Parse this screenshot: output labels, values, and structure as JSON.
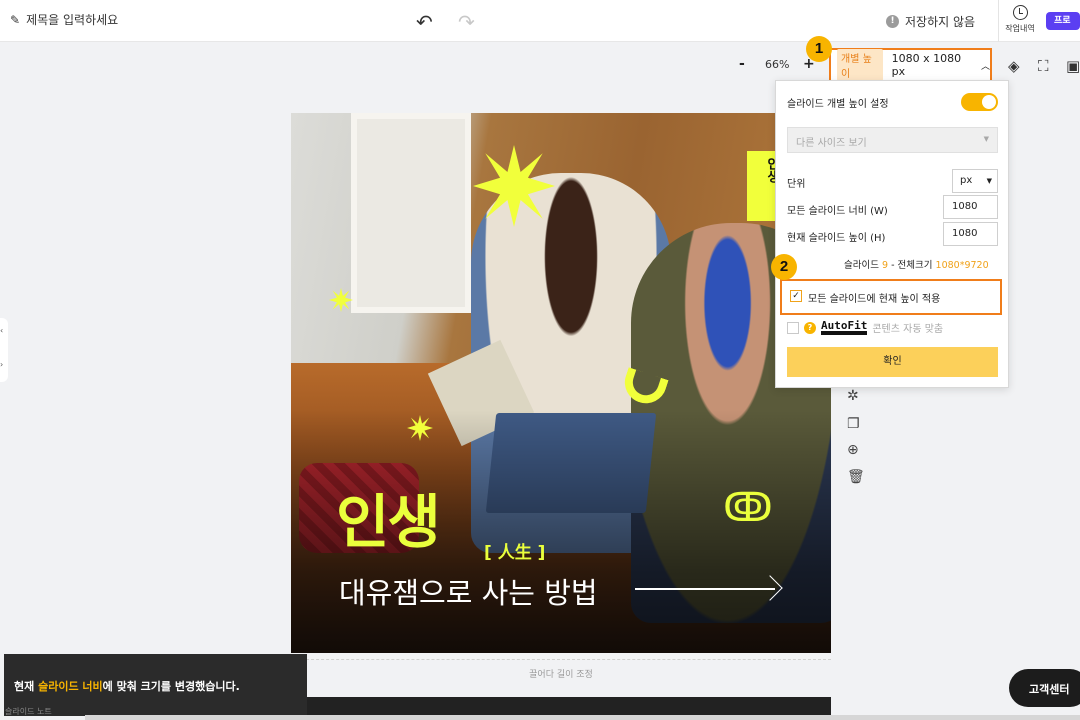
{
  "header": {
    "title_placeholder": "제목을 입력하세요",
    "save_status": "저장하지 않음",
    "history_label": "작업내역",
    "pro_label": "프로"
  },
  "toolbar": {
    "zoom_minus": "-",
    "zoom_value": "66%",
    "zoom_plus": "+",
    "size_tag": "개별 높이",
    "size_value": "1080 x 1080 px"
  },
  "markers": [
    "1",
    "2"
  ],
  "panel": {
    "individual_height_label": "슬라이드 개별 높이 설정",
    "individual_height_on": true,
    "other_sizes": "다른 사이즈 보기",
    "unit_label": "단위",
    "unit_value": "px",
    "width_label": "모든 슬라이드 너비 (W)",
    "width_value": "1080",
    "height_label": "현재 슬라이드 높이 (H)",
    "height_value": "1080",
    "slide_prefix": "슬라이드",
    "slide_count": "9",
    "total_size_label": "- 전체크기",
    "total_size_value": "1080*9720",
    "apply_all_label": "모든 슬라이드에 현재 높이 적용",
    "apply_all_checked": true,
    "autofit_logo": "AutoFit",
    "autofit_label": "콘텐츠 자동 맞춤",
    "confirm_label": "확인"
  },
  "slide": {
    "headline": "인생",
    "headline_hanja": "[ 人生 ]",
    "subline": "대유잼으로 사는 방법",
    "sticker_text": "인생"
  },
  "canvas_footer": {
    "drag_hint": "끌어다 길이 조정"
  },
  "toast": {
    "prefix": "현재 ",
    "highlight": "슬라이드 너비",
    "suffix": "에 맞춰 크기를 변경했습니다."
  },
  "slide_note": "슬라이드 노트",
  "help_button": "고객센터",
  "colors": {
    "accent_orange": "#f07d1a",
    "accent_yellow": "#f8b400",
    "headline_yellow": "#eaff3c",
    "pro_purple": "#5b3ff2"
  }
}
